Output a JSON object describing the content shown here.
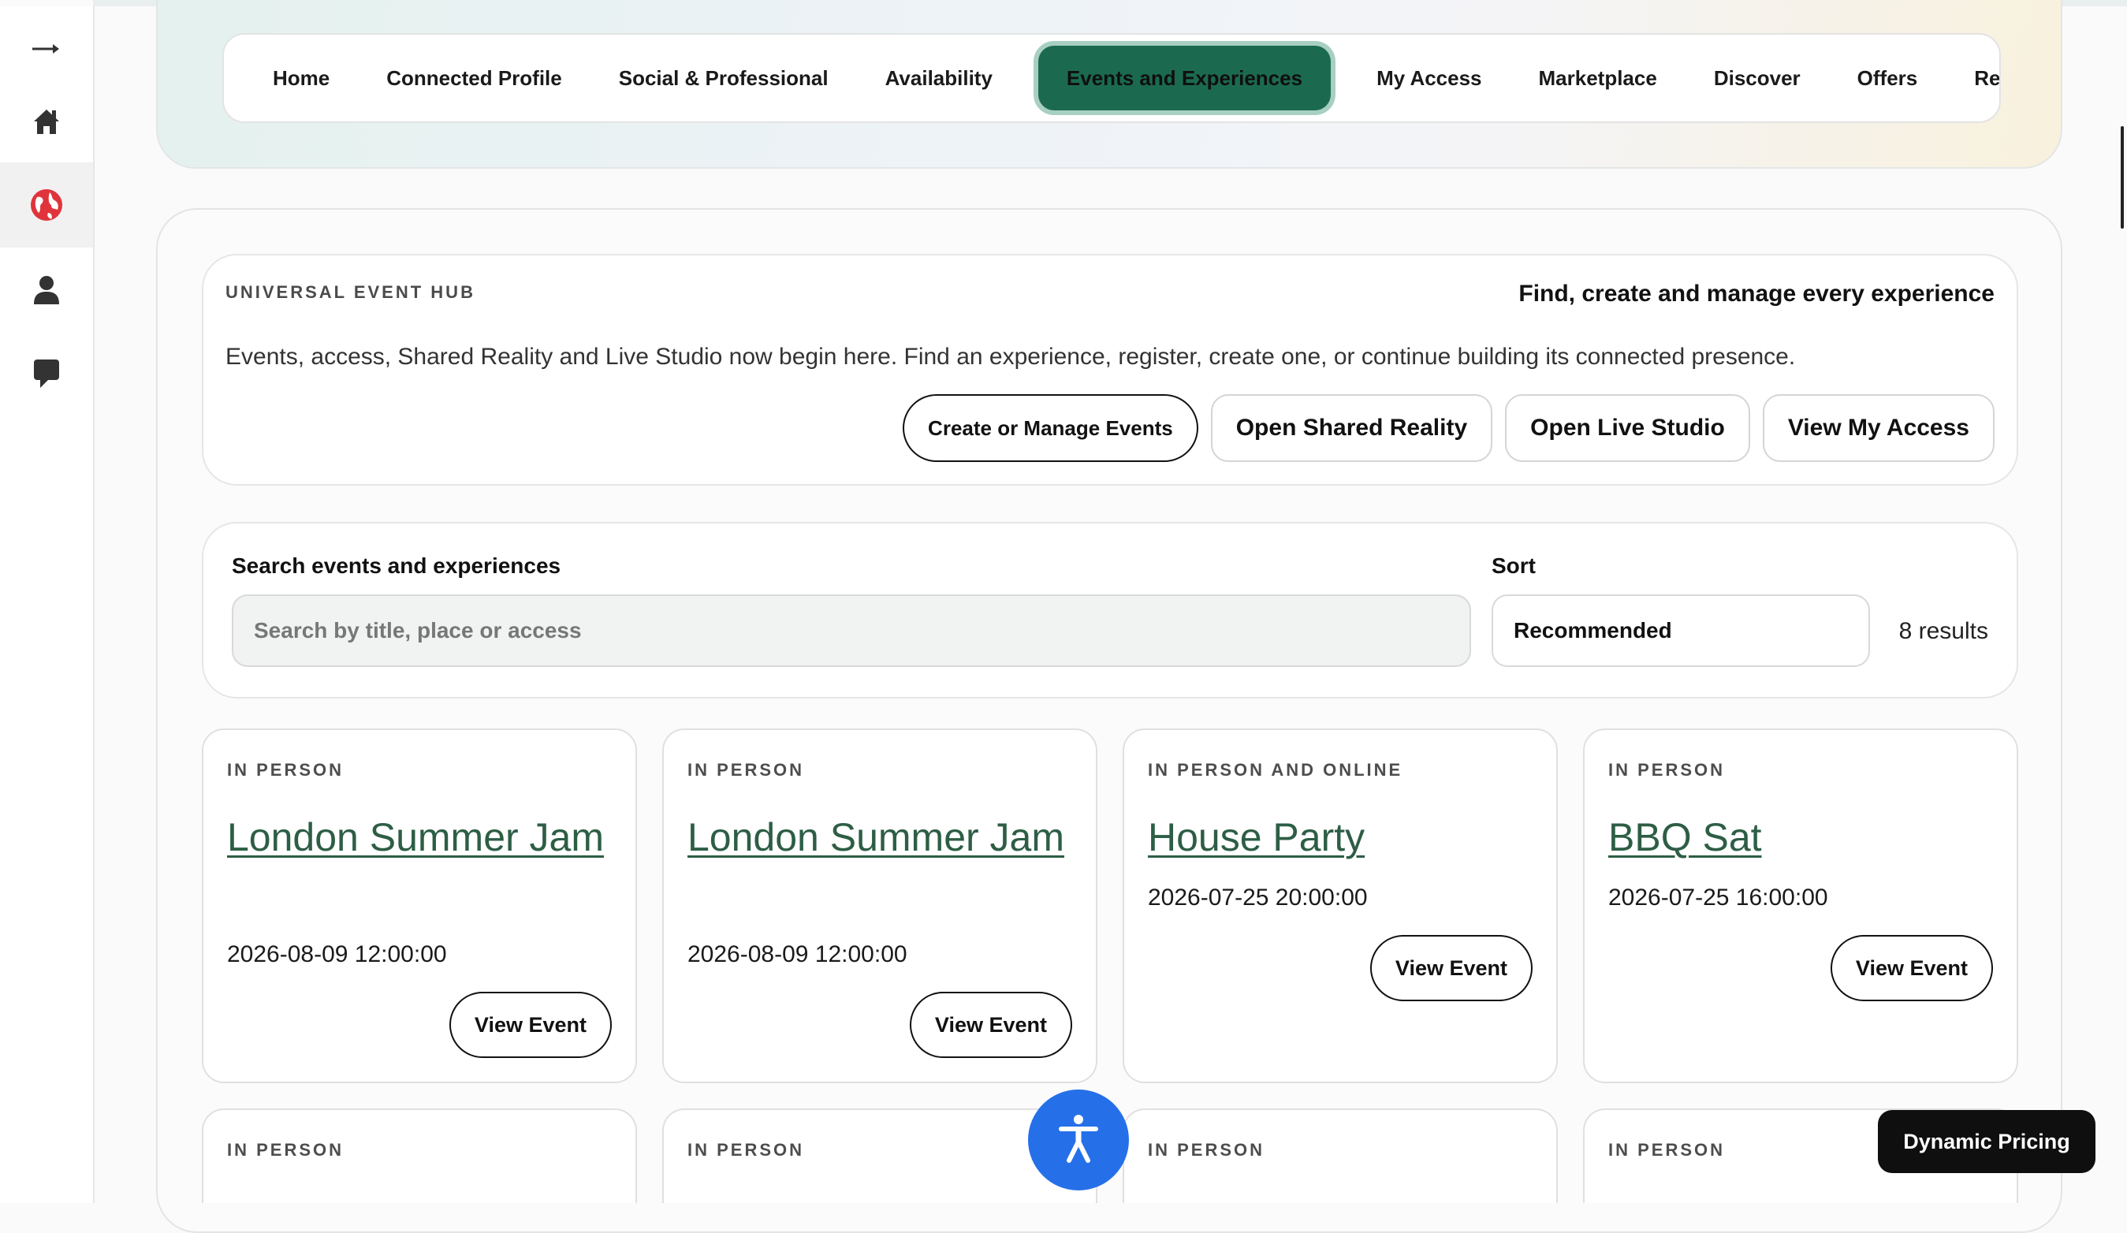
{
  "nav": {
    "tabs": [
      {
        "label": "Home"
      },
      {
        "label": "Connected Profile"
      },
      {
        "label": "Social & Professional"
      },
      {
        "label": "Availability"
      },
      {
        "label": "Events and Experiences"
      },
      {
        "label": "My Access"
      },
      {
        "label": "Marketplace"
      },
      {
        "label": "Discover"
      },
      {
        "label": "Offers"
      },
      {
        "label": "Reque"
      }
    ],
    "active_tab": "Events and Experiences"
  },
  "rail": {
    "icons": [
      "arrow-right-icon",
      "home-icon",
      "globe-icon",
      "person-icon",
      "chat-icon"
    ],
    "active_icon": "globe-icon"
  },
  "hub": {
    "eyebrow": "UNIVERSAL EVENT HUB",
    "tagline": "Find, create and manage every experience",
    "description": "Events, access, Shared Reality and Live Studio now begin here. Find an experience, register, create one, or continue building its connected presence.",
    "actions": {
      "create": "Create or Manage Events",
      "shared_reality": "Open Shared Reality",
      "live_studio": "Open Live Studio",
      "my_access": "View My Access"
    }
  },
  "search": {
    "label": "Search events and experiences",
    "placeholder": "Search by title, place or access",
    "sort_label": "Sort",
    "sort_value": "Recommended",
    "results": "8 results"
  },
  "events": [
    {
      "type": "IN PERSON",
      "title": "London Summer Jam",
      "date": "2026-08-09 12:00:00",
      "button": "View Event"
    },
    {
      "type": "IN PERSON",
      "title": "London Summer Jam",
      "date": "2026-08-09 12:00:00",
      "button": "View Event"
    },
    {
      "type": "IN PERSON AND ONLINE",
      "title": "House Party",
      "date": "2026-07-25 20:00:00",
      "button": "View Event"
    },
    {
      "type": "IN PERSON",
      "title": "BBQ Sat",
      "date": "2026-07-25 16:00:00",
      "button": "View Event"
    },
    {
      "type": "IN PERSON"
    },
    {
      "type": "IN PERSON"
    },
    {
      "type": "IN PERSON"
    },
    {
      "type": "IN PERSON"
    }
  ],
  "floating": {
    "accessibility_icon": "accessibility-icon",
    "dynamic_pricing": "Dynamic Pricing"
  },
  "colors": {
    "accent_green": "#1b6a4f",
    "title_green": "#2d5e45",
    "globe_red": "#e0343c",
    "accessibility_blue": "#2570e8"
  }
}
